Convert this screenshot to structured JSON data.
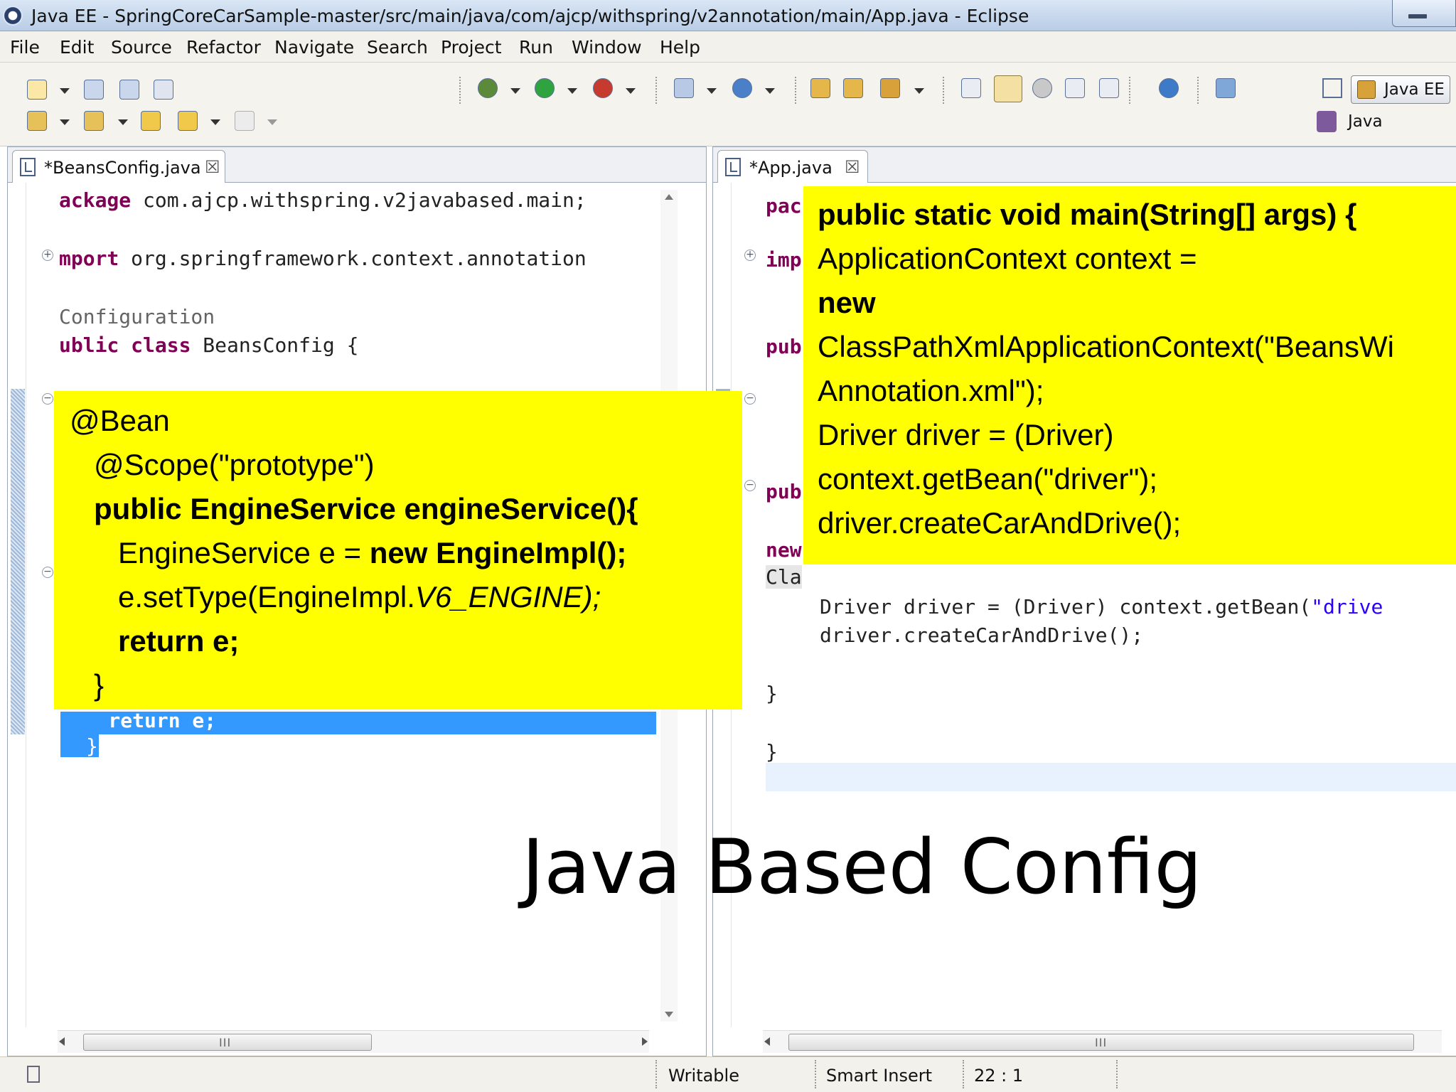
{
  "window": {
    "title": "Java EE - SpringCoreCarSample-master/src/main/java/com/ajcp/withspring/v2annotation/main/App.java - Eclipse"
  },
  "menu": [
    "File",
    "Edit",
    "Source",
    "Refactor",
    "Navigate",
    "Search",
    "Project",
    "Run",
    "Window",
    "Help"
  ],
  "perspectives": {
    "active": "Java EE",
    "other": "Java"
  },
  "left_editor": {
    "tab_label": "*BeansConfig.java",
    "tab_close": "☒",
    "code": {
      "l1_kw": "ackage",
      "l1_rest": " com.ajcp.withspring.v2javabased.main;",
      "l2_kw": "mport",
      "l2_rest": " org.springframework.context.annotation",
      "l3": "Configuration",
      "l4_kw": "ublic class",
      "l4_rest": " BeansConfig {",
      "sel1": "    return e;",
      "sel2": "}"
    }
  },
  "right_editor": {
    "tab_label": "*App.java",
    "tab_close": "☒",
    "code": {
      "r1": "pac",
      "r2": "imp",
      "r3": "pub",
      "r4": "pub",
      "r5": "new",
      "r6": "Cla",
      "r7a": "Driver driver = (Driver) context.getBean(",
      "r7b": "\"drive",
      "r8": "driver.createCarAndDrive();",
      "r9": "}",
      "r10": "}"
    }
  },
  "callout_left": {
    "l1": "@Bean",
    "l2": "@Scope(\"prototype\")",
    "l3": "public EngineService engineService(){",
    "l4a": "EngineService e = ",
    "l4b": "new EngineImpl();",
    "l5a": "e.setType(EngineImpl.",
    "l5b": "V6_ENGINE);",
    "l6": "return e;",
    "l7": "}"
  },
  "callout_right": {
    "l1": "public static void main(String[] args) {",
    "l2": "ApplicationContext context =",
    "l3": "new",
    "l4": "ClassPathXmlApplicationContext(\"BeansWi",
    "l5": "Annotation.xml\");",
    "l6": "Driver driver = (Driver)",
    "l7": "context.getBean(\"driver\");",
    "l8": "driver.createCarAndDrive();"
  },
  "overlay_title": "Java Based Config",
  "status": {
    "writable": "Writable",
    "insert_mode": "Smart Insert",
    "position": "22 : 1"
  },
  "scroll_grip": "III",
  "colors": {
    "callout": "#ffff00",
    "selection": "#3399ff",
    "keyword": "#7f0055"
  }
}
